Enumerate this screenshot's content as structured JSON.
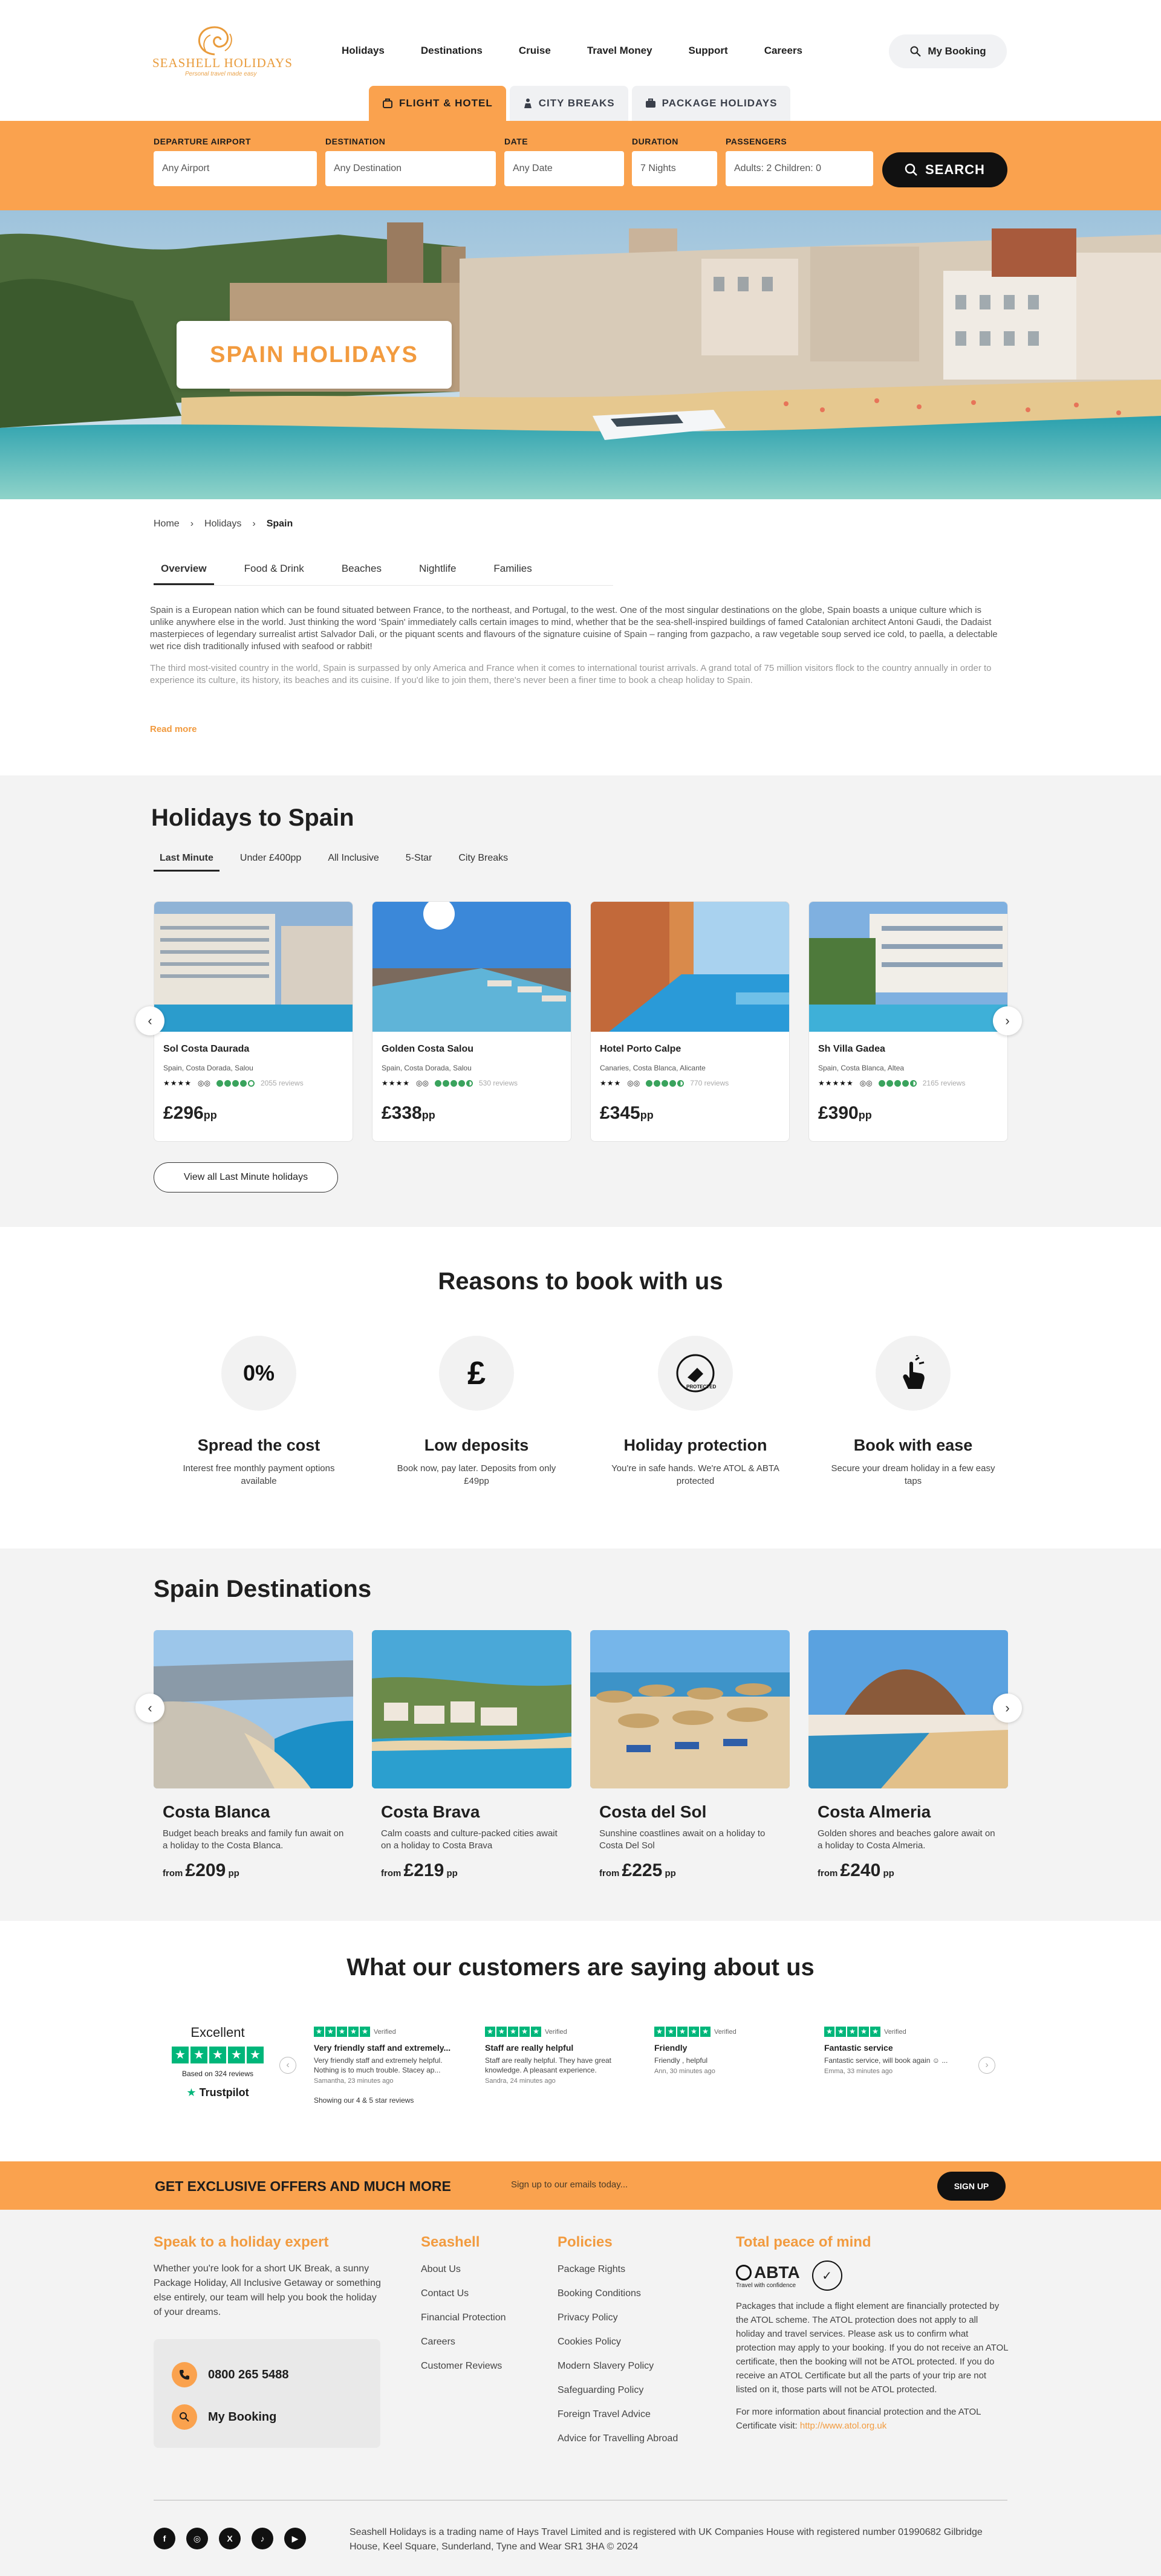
{
  "brand": {
    "name": "SEASHELL HOLIDAYS",
    "tagline": "Personal travel made easy"
  },
  "nav": [
    "Holidays",
    "Destinations",
    "Cruise",
    "Travel Money",
    "Support",
    "Careers"
  ],
  "my_booking": "My Booking",
  "search_tabs": [
    "FLIGHT & HOTEL",
    "CITY BREAKS",
    "PACKAGE HOLIDAYS"
  ],
  "search": {
    "departure_label": "DEPARTURE AIRPORT",
    "departure_value": "Any Airport",
    "destination_label": "DESTINATION",
    "destination_value": "Any Destination",
    "date_label": "DATE",
    "date_value": "Any Date",
    "duration_label": "DURATION",
    "duration_value": "7 Nights",
    "passengers_label": "PASSENGERS",
    "passengers_value": "Adults: 2 Children: 0",
    "button": "SEARCH"
  },
  "hero_title": "SPAIN HOLIDAYS",
  "breadcrumb": [
    "Home",
    "Holidays",
    "Spain"
  ],
  "sub_tabs": [
    "Overview",
    "Food & Drink",
    "Beaches",
    "Nightlife",
    "Families"
  ],
  "intro": {
    "p1": "Spain is a European nation which can be found situated between France, to the northeast, and Portugal, to the west. One of the most singular destinations on the globe, Spain boasts a unique culture which is unlike anywhere else in the world. Just thinking the word 'Spain' immediately calls certain images to mind, whether that be the sea-shell-inspired buildings of famed Catalonian architect Antoni Gaudi, the Dadaist masterpieces of legendary surrealist artist Salvador Dali, or the piquant scents and flavours of the signature cuisine of Spain – ranging from gazpacho, a raw vegetable soup served ice cold, to paella, a delectable wet rice dish traditionally infused with seafood or rabbit!",
    "p2": "The third most-visited country in the world, Spain is surpassed by only America and France when it comes to international tourist arrivals. A grand total of 75 million visitors flock to the country annually in order to experience its culture, its history, its beaches and its cuisine. If you'd like to join them, there's never been a finer time to book a cheap holiday to Spain.",
    "read_more": "Read more"
  },
  "holidays": {
    "title": "Holidays to Spain",
    "tabs": [
      "Last Minute",
      "Under £400pp",
      "All Inclusive",
      "5-Star",
      "City Breaks"
    ],
    "cards": [
      {
        "name": "Sol Costa Daurada",
        "location": "Spain, Costa Dorada, Salou",
        "stars": "★★★★",
        "rating": 4,
        "reviews": "2055 reviews",
        "price": "£296",
        "pp": "pp"
      },
      {
        "name": "Golden Costa Salou",
        "location": "Spain, Costa Dorada, Salou",
        "stars": "★★★★",
        "rating": 4.5,
        "reviews": "530 reviews",
        "price": "£338",
        "pp": "pp"
      },
      {
        "name": "Hotel Porto Calpe",
        "location": "Canaries, Costa Blanca, Alicante",
        "stars": "★★★",
        "rating": 4.5,
        "reviews": "770 reviews",
        "price": "£345",
        "pp": "pp"
      },
      {
        "name": "Sh Villa Gadea",
        "location": "Spain, Costa Blanca, Altea",
        "stars": "★★★★★",
        "rating": 4.5,
        "reviews": "2165 reviews",
        "price": "£390",
        "pp": "pp"
      }
    ],
    "view_all": "View all Last Minute holidays"
  },
  "reasons": {
    "title": "Reasons to book with us",
    "items": [
      {
        "icon": "0%",
        "title": "Spread the cost",
        "desc": "Interest free monthly payment options available"
      },
      {
        "icon": "£",
        "title": "Low deposits",
        "desc": "Book now, pay later. Deposits from only £49pp"
      },
      {
        "icon": "protected-icon",
        "title": "Holiday protection",
        "desc": "You're in safe hands. We're ATOL & ABTA protected"
      },
      {
        "icon": "hand-tap-icon",
        "title": "Book with ease",
        "desc": "Secure your dream holiday in a few easy taps"
      }
    ]
  },
  "destinations": {
    "title": "Spain Destinations",
    "items": [
      {
        "name": "Costa Blanca",
        "desc": "Budget beach breaks and family fun await on a holiday to the Costa Blanca.",
        "from": "from",
        "price": "£209",
        "pp": "pp"
      },
      {
        "name": "Costa Brava",
        "desc": "Calm coasts and culture-packed cities await on a holiday to Costa Brava",
        "from": "from",
        "price": "£219",
        "pp": "pp"
      },
      {
        "name": "Costa del Sol",
        "desc": "Sunshine coastlines await on a holiday to Costa Del Sol",
        "from": "from",
        "price": "£225",
        "pp": "pp"
      },
      {
        "name": "Costa Almeria",
        "desc": "Golden shores and beaches galore await on a holiday to Costa Almeria.",
        "from": "from",
        "price": "£240",
        "pp": "pp"
      }
    ]
  },
  "reviews": {
    "title": "What our customers are saying about us",
    "summary": {
      "label": "Excellent",
      "based": "Based on 324 reviews",
      "brand": "Trustpilot"
    },
    "verified": "Verified",
    "items": [
      {
        "title": "Very friendly staff and extremely...",
        "body": "Very friendly staff and extremely helpful. Nothing is to much trouble. Stacey ap...",
        "author": "Samantha, 23 minutes ago"
      },
      {
        "title": "Staff are really helpful",
        "body": "Staff are really helpful. They have great knowledge. A pleasant experience.",
        "author": "Sandra, 24 minutes ago"
      },
      {
        "title": "Friendly",
        "body": "Friendly , helpful",
        "author": "Ann, 30 minutes ago"
      },
      {
        "title": "Fantastic service",
        "body": "Fantastic service, will book again ☺ ...",
        "author": "Emma, 33 minutes ago"
      }
    ],
    "note": "Showing our 4 & 5 star reviews"
  },
  "offers": {
    "title": "GET EXCLUSIVE OFFERS AND MUCH MORE",
    "input_placeholder": "Sign up to our emails today...",
    "button": "SIGN UP"
  },
  "footer": {
    "expert_title": "Speak to a holiday expert",
    "expert_text": "Whether you're look for a short UK Break, a sunny Package Holiday, All Inclusive Getaway or something else entirely, our team will help you book the holiday of your dreams.",
    "phone": "0800 265 5488",
    "booking": "My Booking",
    "seashell_title": "Seashell",
    "seashell_links": [
      "About Us",
      "Contact Us",
      "Financial Protection",
      "Careers",
      "Customer Reviews"
    ],
    "policies_title": "Policies",
    "policies_links": [
      "Package Rights",
      "Booking Conditions",
      "Privacy Policy",
      "Cookies Policy",
      "Modern Slavery Policy",
      "Safeguarding Policy",
      "Foreign Travel Advice",
      "Advice for Travelling Abroad"
    ],
    "peace_title": "Total peace of mind",
    "abta": "ABTA",
    "abta_sub": "Travel with confidence",
    "peace_text": "Packages that include a flight element are financially protected by the ATOL scheme. The ATOL protection does not apply to all holiday and travel services. Please ask us to confirm what protection may apply to your booking. If you do not receive an ATOL certificate, then the booking will not be ATOL protected. If you do receive an ATOL Certificate but all the parts of your trip are not listed on it, those parts will not be ATOL protected.",
    "peace_text2": "For more information about financial protection and the ATOL Certificate visit:",
    "atol_link": "http://www.atol.org.uk",
    "legal": "Seashell Holidays is a trading name of Hays Travel Limited and is registered with UK Companies House with registered number 01990682 Gilbridge House, Keel Square, Sunderland, Tyne and Wear SR1 3HA © 2024",
    "socials": [
      "f",
      "◎",
      "X",
      "♪",
      "▶"
    ]
  },
  "colors": {
    "accent": "#faa24e",
    "heading_orange": "#f29b3f",
    "trustpilot_green": "#00b67a"
  }
}
